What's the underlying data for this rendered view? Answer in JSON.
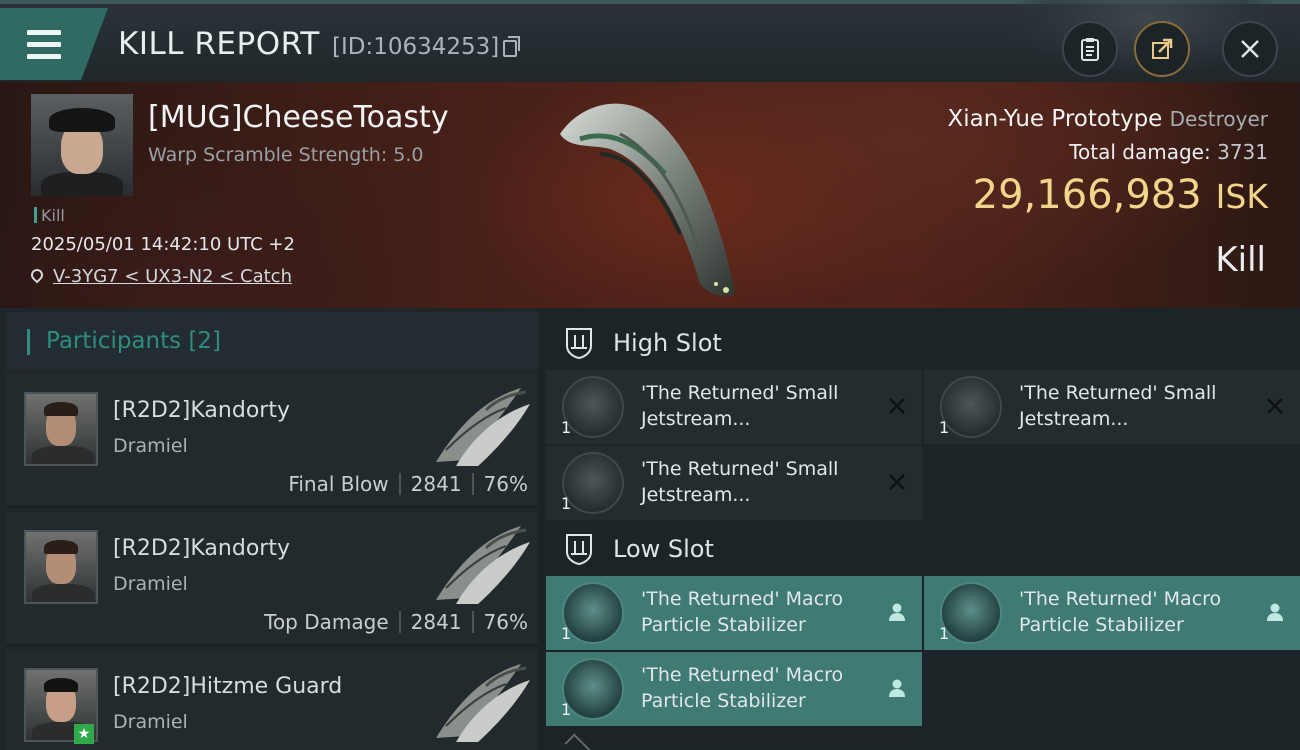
{
  "header": {
    "title": "KILL REPORT",
    "report_id": "[ID:10634253]"
  },
  "victim": {
    "name": "[MUG]CheeseToasty",
    "scramble": "Warp Scramble Strength: 5.0",
    "tag": "Kill",
    "datetime": "2025/05/01 14:42:10 UTC +2",
    "location": "V-3YG7 < UX3-N2 < Catch"
  },
  "ship": {
    "name": "Xian-Yue Prototype",
    "class": "Destroyer",
    "total_damage_label": "Total damage:",
    "total_damage": "3731",
    "isk_value": "29,166,983",
    "isk_unit": "ISK",
    "result": "Kill"
  },
  "participants": {
    "label": "Participants",
    "count": "[2]",
    "rows": [
      {
        "name": "[R2D2]Kandorty",
        "ship": "Dramiel",
        "role": "Final Blow",
        "damage": "2841",
        "percent": "76%"
      },
      {
        "name": "[R2D2]Kandorty",
        "ship": "Dramiel",
        "role": "Top Damage",
        "damage": "2841",
        "percent": "76%"
      },
      {
        "name": "[R2D2]Hitzme Guard",
        "ship": "Dramiel"
      }
    ]
  },
  "fitting": {
    "high_slot": {
      "label": "High Slot",
      "modules": [
        {
          "name_line1": "'The Returned' Small",
          "name_line2": "Jetstream...",
          "qty": "1",
          "status_icon": "close-icon"
        },
        {
          "name_line1": "'The Returned' Small",
          "name_line2": "Jetstream...",
          "qty": "1",
          "status_icon": "close-icon"
        },
        {
          "name_line1": "'The Returned' Small",
          "name_line2": "Jetstream...",
          "qty": "1",
          "status_icon": "close-icon"
        }
      ]
    },
    "low_slot": {
      "label": "Low Slot",
      "modules": [
        {
          "name_line1": "'The Returned' Macro",
          "name_line2": "Particle Stabilizer",
          "qty": "1",
          "status_icon": "person-icon"
        },
        {
          "name_line1": "'The Returned' Macro",
          "name_line2": "Particle Stabilizer",
          "qty": "1",
          "status_icon": "person-icon"
        },
        {
          "name_line1": "'The Returned' Macro",
          "name_line2": "Particle Stabilizer",
          "qty": "1",
          "status_icon": "person-icon"
        }
      ]
    }
  },
  "colors": {
    "accent_teal": "#2e8d80",
    "isk_gold": "#f1d58a",
    "low_slot_bg": "#3f7a73"
  }
}
